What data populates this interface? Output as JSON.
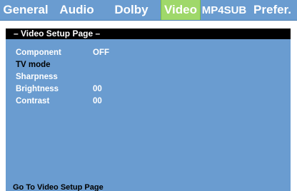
{
  "tabs": [
    {
      "label": "General",
      "active": false
    },
    {
      "label": "Audio",
      "active": false
    },
    {
      "label": "Dolby",
      "active": false
    },
    {
      "label": "Video",
      "active": true
    },
    {
      "label": "MP4SUB",
      "active": false
    },
    {
      "label": "Prefer.",
      "active": false
    }
  ],
  "page": {
    "title": "– Video Setup Page –"
  },
  "settings": [
    {
      "label": "Component",
      "value": "OFF"
    },
    {
      "label": "TV mode",
      "value": ""
    },
    {
      "label": "Sharpness",
      "value": ""
    },
    {
      "label": "Brightness",
      "value": "00"
    },
    {
      "label": "Contrast",
      "value": "00"
    }
  ],
  "status": {
    "text": "Go To Video Setup Page"
  },
  "colors": {
    "tab_bar": "#6a9cd0",
    "active_tab": "#9fd86a",
    "panel": "#6a9cd0",
    "title_bar": "#000000"
  }
}
